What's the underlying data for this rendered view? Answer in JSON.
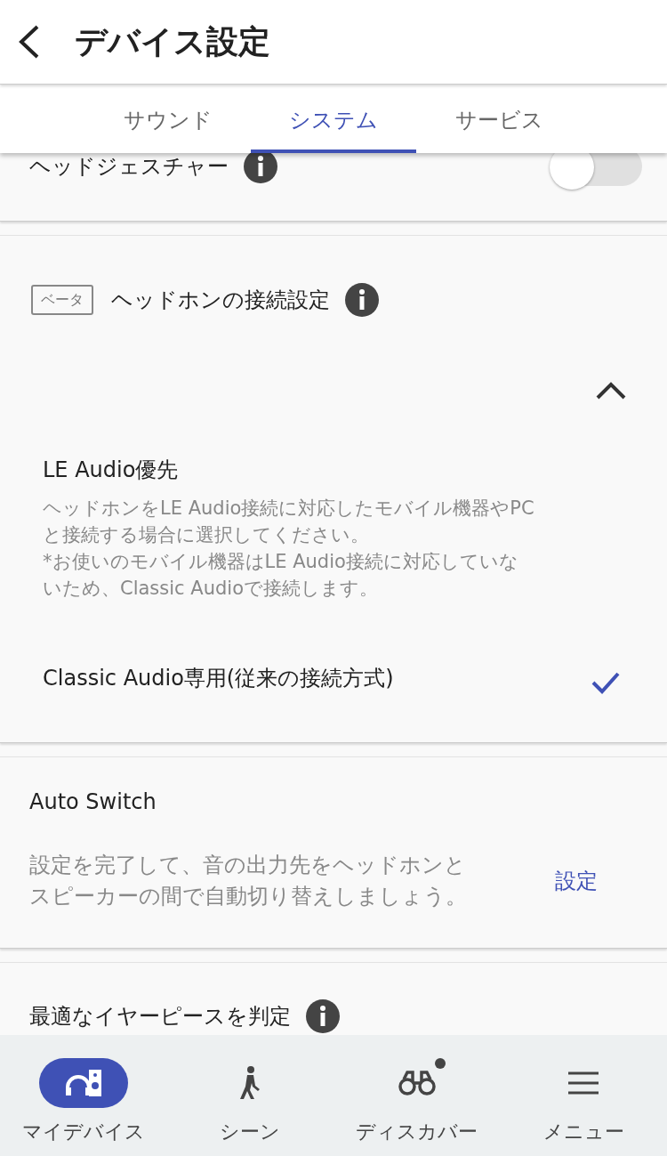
{
  "header": {
    "title": "デバイス設定"
  },
  "tabs": [
    {
      "label": "サウンド",
      "selected": false
    },
    {
      "label": "システム",
      "selected": true
    },
    {
      "label": "サービス",
      "selected": false
    }
  ],
  "sections": [
    {
      "kind": "toggle",
      "label": "ヘッドジェスチャー",
      "info": true,
      "on": false
    },
    {
      "kind": "options",
      "badge": "ベータ",
      "title": "ヘッドホンの接続設定",
      "info": true,
      "expanded": true,
      "options": [
        {
          "title": "LE Audio優先",
          "description": [
            "ヘッドホンをLE Audio接続に対応したモバイル機器やPCと接続する場合に選択してください。",
            "*お使いのモバイル機器はLE Audio接続に対応していないため、Classic Audioで接続します。"
          ],
          "selected": false
        },
        {
          "title": "Classic Audio専用(従来の接続方式)",
          "selected": true
        }
      ]
    },
    {
      "kind": "action",
      "title": "Auto Switch",
      "description": "設定を完了して、音の出力先をヘッドホンとスピーカーの間で自動切り替えしましょう。",
      "action": "設定"
    },
    {
      "kind": "title",
      "label": "最適なイヤーピースを判定",
      "info": true
    }
  ],
  "nav": [
    {
      "label": "マイデバイス",
      "kind": "device",
      "selected": true,
      "dot": false
    },
    {
      "label": "シーン",
      "kind": "walk",
      "selected": false,
      "dot": false
    },
    {
      "label": "ディスカバー",
      "kind": "binoculars",
      "selected": false,
      "dot": true
    },
    {
      "label": "メニュー",
      "kind": "menu",
      "selected": false,
      "dot": false
    }
  ]
}
